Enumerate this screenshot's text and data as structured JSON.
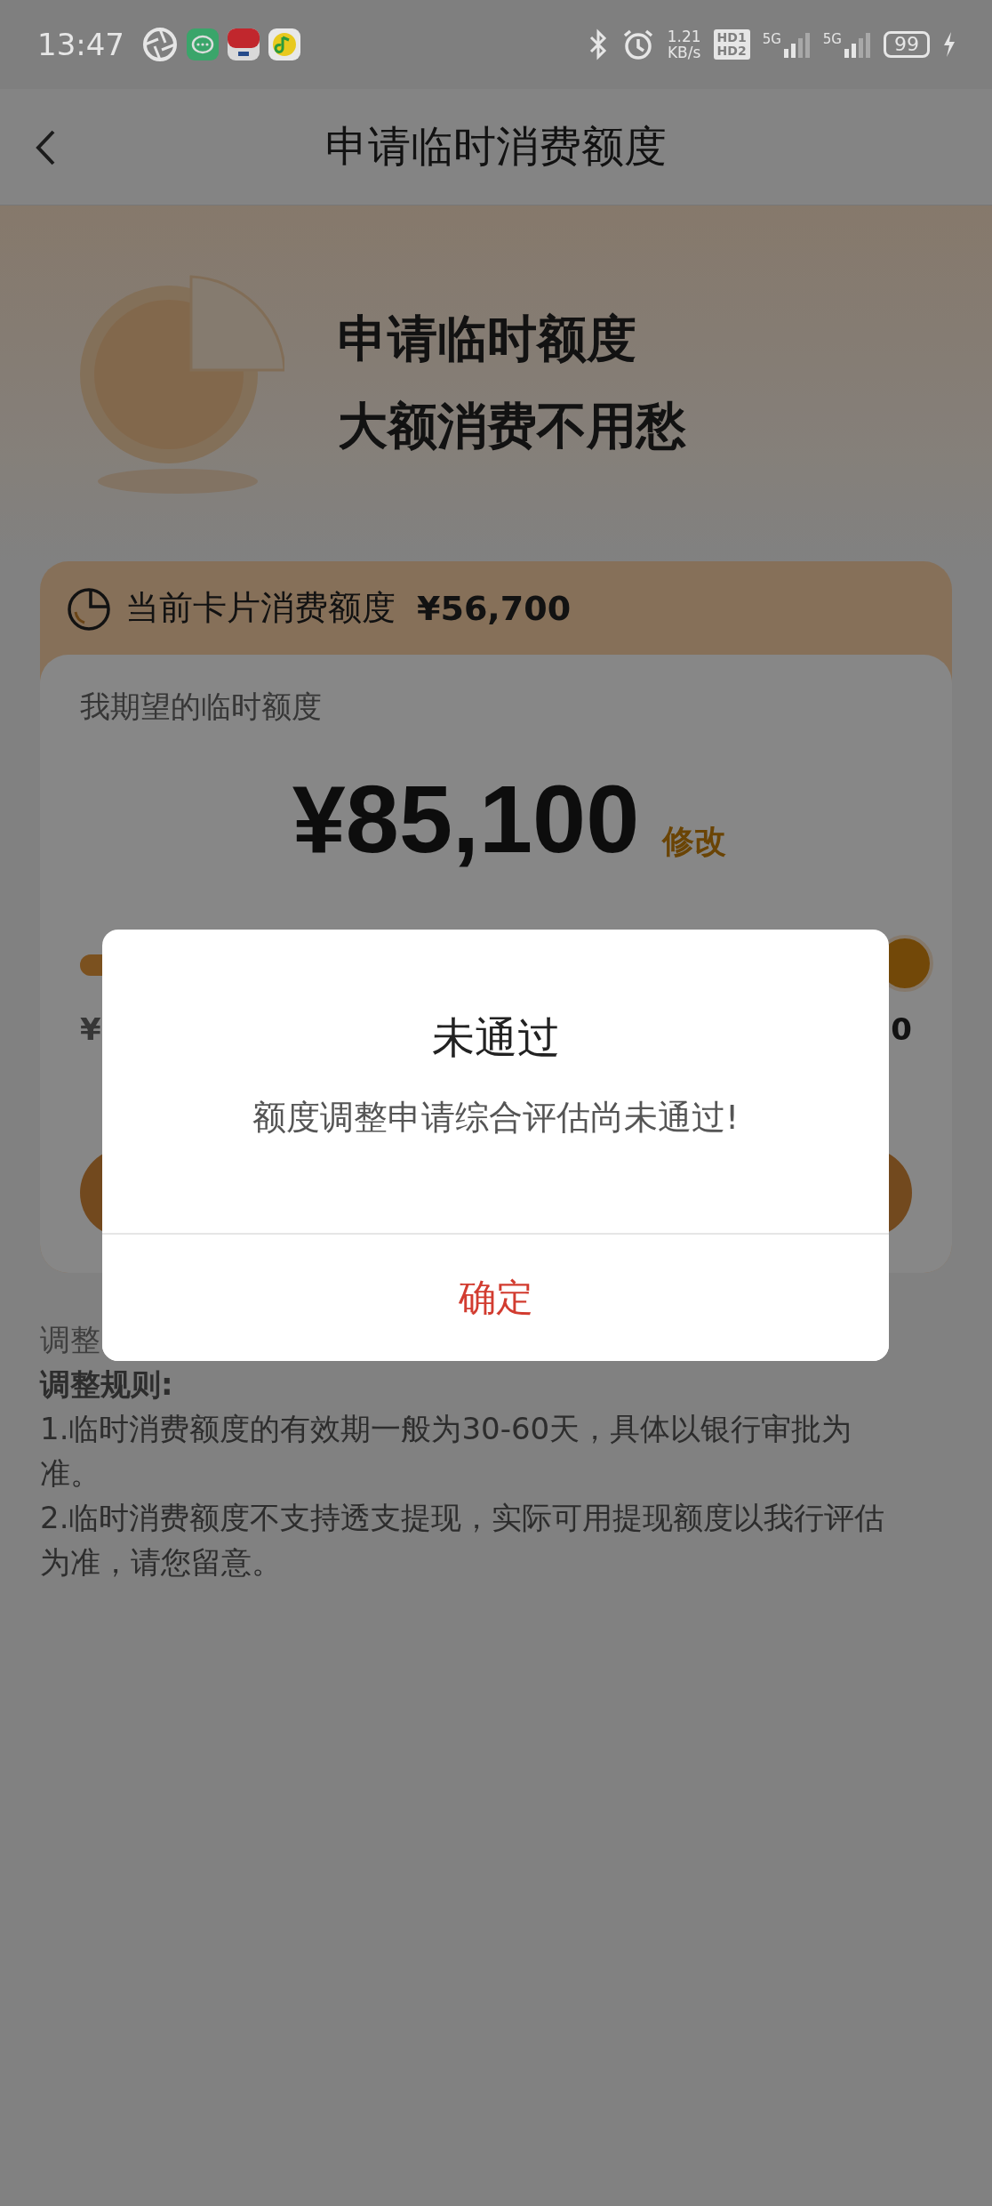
{
  "status_bar": {
    "time": "13:47",
    "speed_value": "1.21",
    "speed_unit": "KB/s",
    "hd_labels": [
      "HD1",
      "HD2"
    ],
    "signals": [
      "5G",
      "5G"
    ],
    "battery": "99"
  },
  "header": {
    "title": "申请临时消费额度"
  },
  "hero": {
    "lines": [
      "申请临时额度",
      "大额消费不用愁"
    ]
  },
  "current_limit": {
    "label": "当前卡片消费额度",
    "amount": "¥56,700"
  },
  "expected": {
    "label": "我期望的临时额度",
    "amount": "¥85,100",
    "edit_link": "修改",
    "slider": {
      "level": 1
    },
    "min_value": "¥",
    "max_value": "0"
  },
  "rules": {
    "faded_title": "调整",
    "title": "调整规则:",
    "items": [
      "1.临时消费额度的有效期一般为30-60天，具体以银行审批为准。",
      "2.临时消费额度不支持透支提现，实际可用提现额度以我行评估为准，请您留意。"
    ]
  },
  "dialog": {
    "title": "未通过",
    "message": "额度调整申请综合评估尚未通过!",
    "confirm": "确定"
  }
}
